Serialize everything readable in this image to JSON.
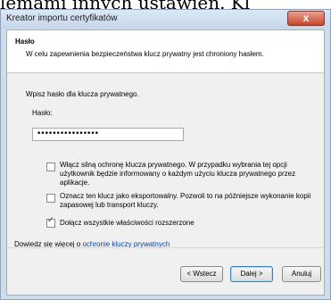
{
  "background": {
    "text": "lemami innych ustawień. Kl"
  },
  "window": {
    "title": "Kreator importu certyfikatów",
    "close_label": "x"
  },
  "header": {
    "title": "Hasło",
    "description": "W celu zapewnienia bezpieczeństwa klucz prywatny jest chroniony hasłem."
  },
  "form": {
    "prompt": "Wpisz hasło dla klucza prywatnego.",
    "password_label": "Hasło:",
    "password_value": "••••••••••••••••"
  },
  "options": [
    {
      "lines": [
        "Włącz silną ochronę klucza prywatnego. W przypadku wybrania tej opcji",
        "użytkownik będzie informowany o każdym użyciu klucza prywatnego przez",
        "aplikacje."
      ],
      "checked": false
    },
    {
      "lines": [
        "Oznacz ten klucz jako eksportowalny. Pozwoli to na późniejsze wykonanie kopii",
        "zapasowej lub transport kluczy."
      ],
      "checked": false
    },
    {
      "lines": [
        "Dołącz wszystkie właściwości rozszerzone"
      ],
      "checked": true
    }
  ],
  "learn_more": {
    "prefix": "Dowiedz się więcej o ",
    "link": "ochronie kluczy prywatnych"
  },
  "buttons": {
    "back": "< Wstecz",
    "next": "Dalej >",
    "cancel": "Anuluj"
  }
}
